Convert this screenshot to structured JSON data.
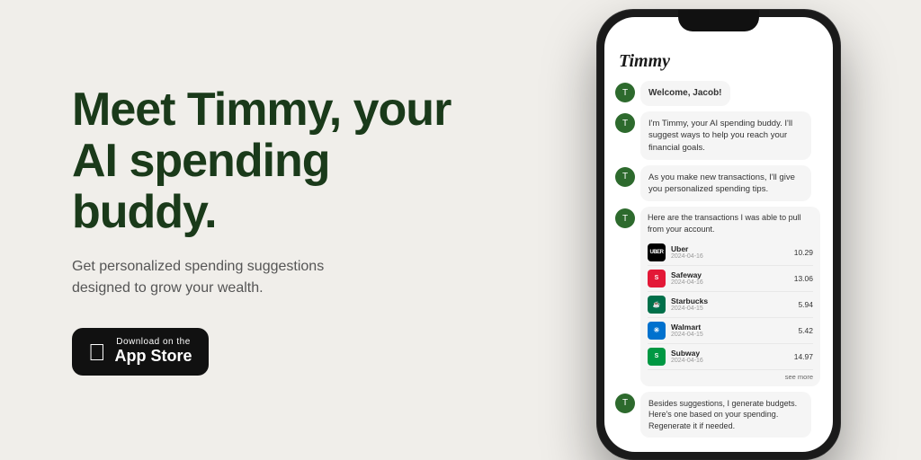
{
  "page": {
    "background": "#f0eeea"
  },
  "left": {
    "headline": "Meet Timmy, your AI spending buddy.",
    "subheadline": "Get personalized spending suggestions designed to grow your wealth.",
    "app_store_button": {
      "top_text": "Download on the",
      "bottom_text": "App Store"
    }
  },
  "phone": {
    "app_title": "Timmy",
    "messages": [
      {
        "text": "Welcome, Jacob!"
      },
      {
        "text": "I'm Timmy, your AI spending buddy. I'll suggest ways to help you reach your financial goals."
      },
      {
        "text": "As you make new transactions, I'll give you personalized spending tips."
      },
      {
        "text": "Here are the transactions I was able to pull from your account."
      }
    ],
    "transactions": [
      {
        "name": "Uber",
        "date": "2024-04-16",
        "amount": "10.29",
        "brand": "uber"
      },
      {
        "name": "Safeway",
        "date": "2024-04-16",
        "amount": "13.06",
        "brand": "safeway"
      },
      {
        "name": "Starbucks",
        "date": "2024-04-15",
        "amount": "5.94",
        "brand": "starbucks"
      },
      {
        "name": "Walmart",
        "date": "2024-04-15",
        "amount": "5.42",
        "brand": "walmart"
      },
      {
        "name": "Subway",
        "date": "2024-04-16",
        "amount": "14.97",
        "brand": "subway"
      }
    ],
    "see_more": "see more",
    "last_message": "Besides suggestions, I generate budgets. Here's one based on your spending. Regenerate it if needed."
  }
}
